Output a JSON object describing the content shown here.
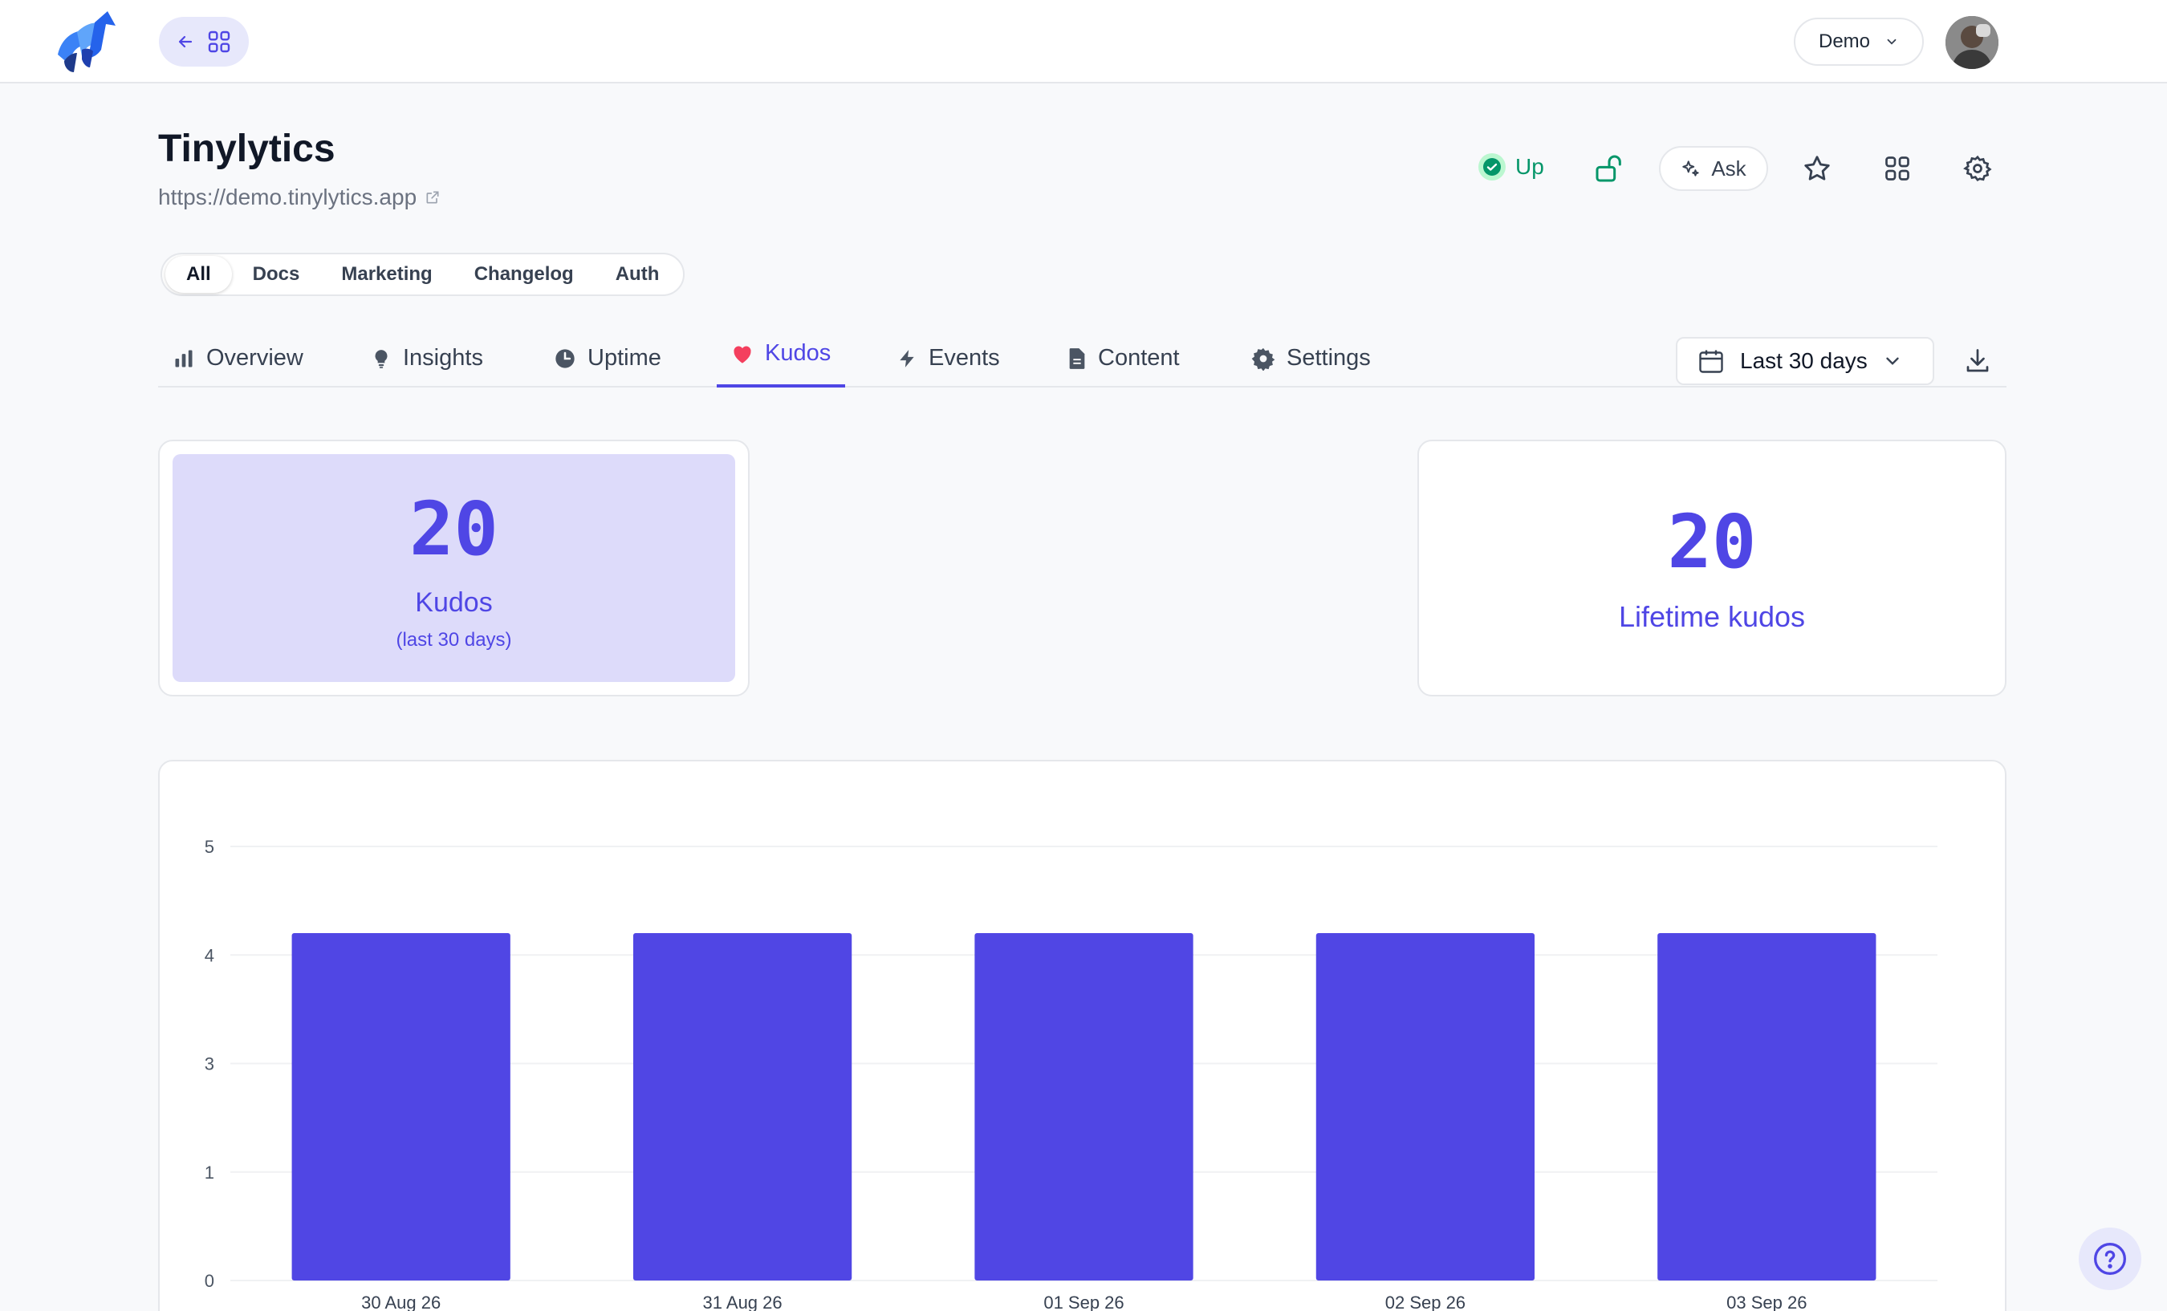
{
  "topbar": {
    "workspace_label": "Demo"
  },
  "site": {
    "title": "Tinylytics",
    "url": "https://demo.tinylytics.app",
    "status_label": "Up",
    "ask_label": "Ask"
  },
  "segments": [
    "All",
    "Docs",
    "Marketing",
    "Changelog",
    "Auth"
  ],
  "tabs": {
    "overview": "Overview",
    "insights": "Insights",
    "uptime": "Uptime",
    "kudos": "Kudos",
    "events": "Events",
    "content": "Content",
    "settings": "Settings"
  },
  "date_range": "Last 30 days",
  "stats": {
    "kudos_value": "20",
    "kudos_label": "Kudos",
    "kudos_sub": "(last 30 days)",
    "lifetime_value": "20",
    "lifetime_label": "Lifetime kudos"
  },
  "colors": {
    "accent": "#4f46e5",
    "bar": "#5046e4",
    "status_green": "#059669",
    "kudos_heart": "#f43f5e"
  },
  "icons": [
    "logo-icon",
    "arrow-left-icon",
    "grid-icon",
    "chevron-down-icon",
    "check-circle-icon",
    "unlock-icon",
    "sparkles-icon",
    "star-icon",
    "gear-icon",
    "bar-chart-icon",
    "lightbulb-icon",
    "clock-icon",
    "heart-icon",
    "bolt-icon",
    "document-icon",
    "calendar-icon",
    "download-icon",
    "external-link-icon",
    "help-icon"
  ],
  "chart_data": {
    "type": "bar",
    "categories": [
      "30 Aug 26",
      "31 Aug 26",
      "01 Sep 26",
      "02 Sep 26",
      "03 Sep 26"
    ],
    "values": [
      4,
      4,
      4,
      4,
      4
    ],
    "yticks": [
      "0",
      "1",
      "3",
      "4",
      "5"
    ],
    "ylim": [
      0,
      5
    ],
    "grid": true,
    "title": "",
    "xlabel": "",
    "ylabel": ""
  }
}
